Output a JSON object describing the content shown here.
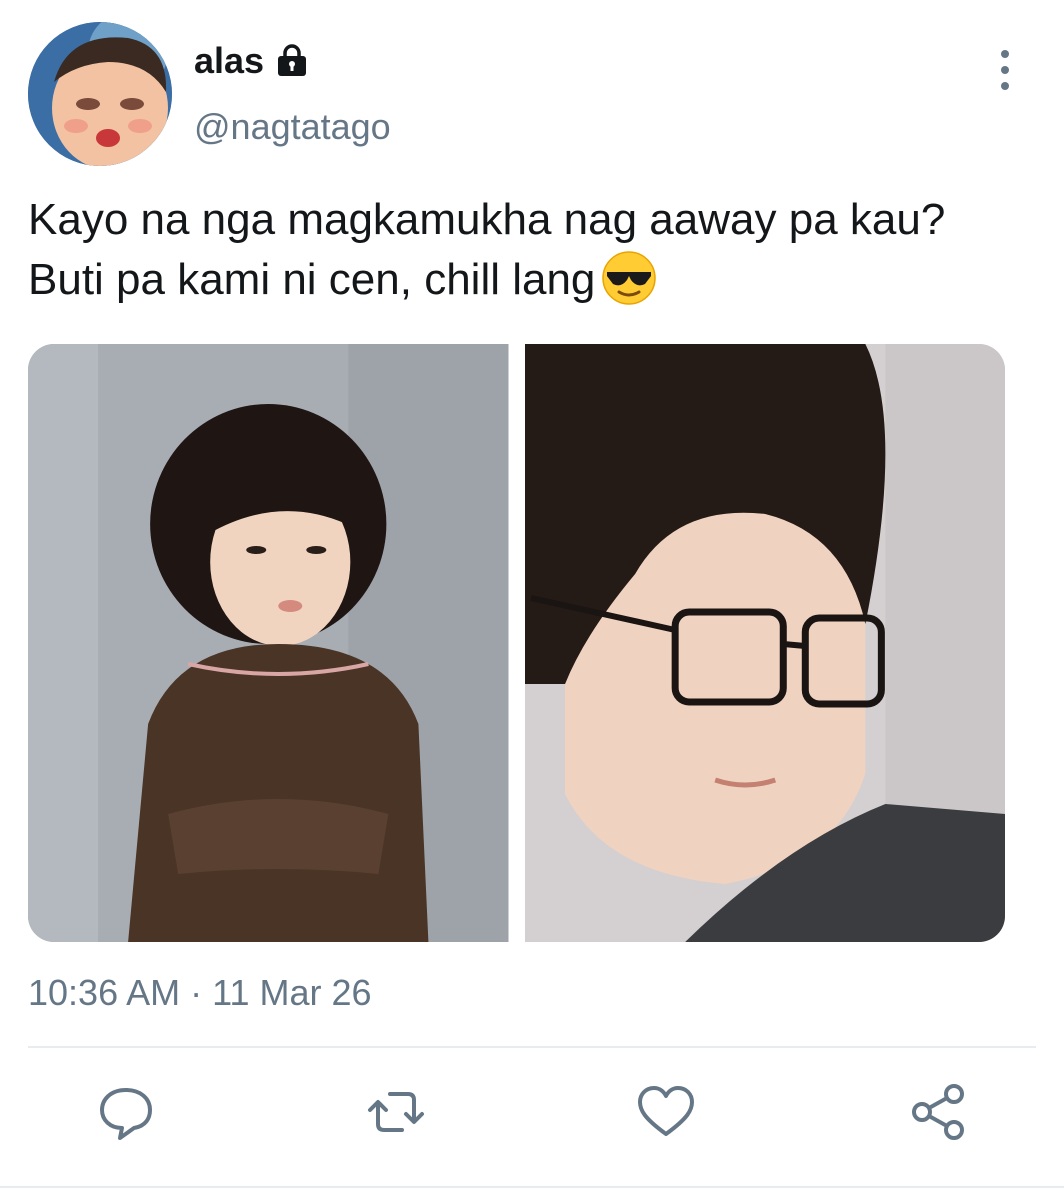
{
  "user": {
    "display_name": "alas",
    "handle": "@nagtatago"
  },
  "tweet": {
    "text": "Kayo na nga magkamukha nag aaway pa kau? Buti pa kami ni cen, chill lang",
    "emoji": "smiling-face-with-sunglasses",
    "timestamp": "10:36 AM · 11 Mar 26"
  },
  "media": [
    {
      "description_icon": "photo-child"
    },
    {
      "description_icon": "photo-man-glasses"
    }
  ],
  "actions": [
    "reply-icon",
    "retweet-icon",
    "like-icon",
    "share-icon"
  ],
  "colors": {
    "text": "#14171a",
    "secondary": "#657786",
    "divider": "#e6ecf0"
  }
}
